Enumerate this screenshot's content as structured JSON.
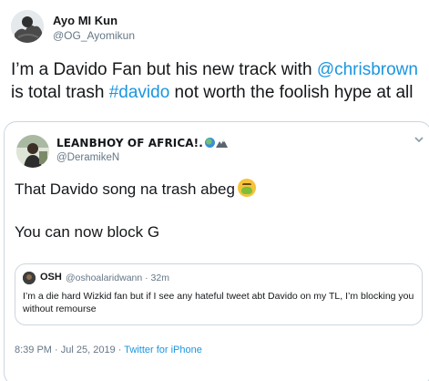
{
  "tweet": {
    "author_name": "Ayo MI Kun",
    "author_handle": "@OG_Ayomikun",
    "text_part1": "I’m a Davido Fan but his new track with ",
    "mention": "@chrisbrown",
    "text_part2": " is total trash ",
    "hashtag": "#davido",
    "text_part3": " not worth the foolish hype at all"
  },
  "quoted_tweet": {
    "author_name": "LEANBHOY OF AFRICA!.",
    "author_handle": "@DeramikeN",
    "line1": "That Davido song na trash abeg",
    "line2": "You can now block G",
    "footer_time": "8:39 PM · Jul 25, 2019 · ",
    "footer_source": "Twitter for iPhone"
  },
  "inner_quote": {
    "author_name": "OSH",
    "author_handle": "@oshoalaridwann · 32m",
    "text": "I’m a die hard Wizkid fan but if I see any hateful tweet abt Davido on my TL, I’m blocking you without remourse"
  },
  "icons": {
    "caret": "chevron-down-icon",
    "globe": "globe-emoji-icon",
    "mountain": "mountain-emoji-icon",
    "nausea": "nauseated-face-emoji-icon"
  },
  "colors": {
    "link": "#1b95e0",
    "secondary_text": "#657786",
    "border": "#ccd6dd"
  }
}
